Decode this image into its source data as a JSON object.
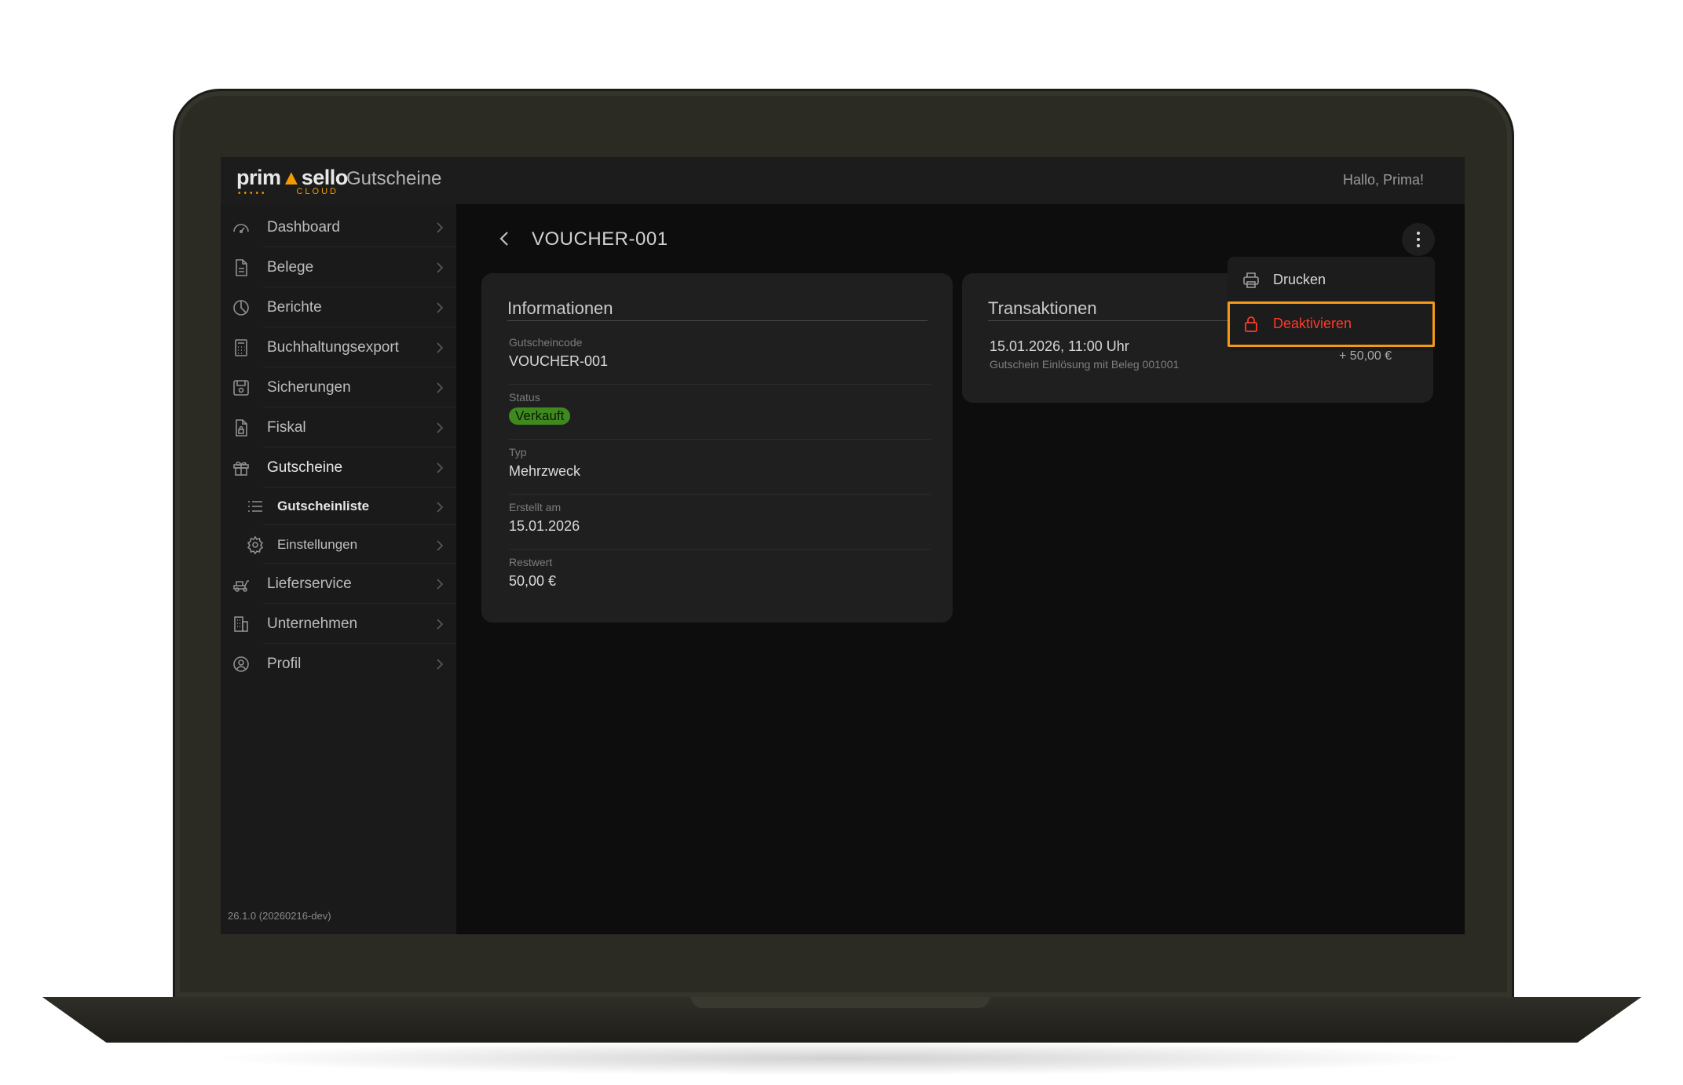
{
  "header": {
    "logo": {
      "word_a": "prim",
      "word_b": "sello",
      "sub": "CLOUD"
    },
    "app_title": "Gutscheine",
    "greeting": "Hallo, Prima!"
  },
  "sidebar": {
    "items": [
      {
        "label": "Dashboard",
        "icon": "gauge-icon"
      },
      {
        "label": "Belege",
        "icon": "document-icon"
      },
      {
        "label": "Berichte",
        "icon": "pie-chart-icon"
      },
      {
        "label": "Buchhaltungsexport",
        "icon": "calculator-icon"
      },
      {
        "label": "Sicherungen",
        "icon": "save-icon"
      },
      {
        "label": "Fiskal",
        "icon": "lock-document-icon"
      },
      {
        "label": "Gutscheine",
        "icon": "gift-icon"
      }
    ],
    "sub_items": [
      {
        "label": "Gutscheinliste",
        "icon": "list-icon"
      },
      {
        "label": "Einstellungen",
        "icon": "gear-icon"
      }
    ],
    "items_after": [
      {
        "label": "Lieferservice",
        "icon": "delivery-icon"
      },
      {
        "label": "Unternehmen",
        "icon": "building-icon"
      },
      {
        "label": "Profil",
        "icon": "user-circle-icon"
      }
    ],
    "version": "26.1.0 (20260216-dev)"
  },
  "main": {
    "title": "VOUCHER-001",
    "info_card": {
      "title": "Informationen",
      "fields": [
        {
          "label": "Gutscheincode",
          "value": "VOUCHER-001"
        },
        {
          "label": "Status",
          "value": "Verkauft"
        },
        {
          "label": "Typ",
          "value": "Mehrzweck"
        },
        {
          "label": "Erstellt am",
          "value": "15.01.2026"
        },
        {
          "label": "Restwert",
          "value": "50,00 €"
        }
      ]
    },
    "transactions_card": {
      "title": "Transaktionen",
      "items": [
        {
          "date": "15.01.2026, 11:00 Uhr",
          "description": "Gutschein Einlösung mit Beleg 001001",
          "amount": "+ 50,00 €"
        }
      ]
    },
    "menu": {
      "items": [
        {
          "label": "Drucken",
          "icon": "printer-icon"
        },
        {
          "label": "Deaktivieren",
          "icon": "lock-icon"
        }
      ]
    }
  },
  "colors": {
    "accent": "#f29a00",
    "status_green": "#3f8a1e",
    "danger": "#ff3b2a",
    "highlight": "#f29a16"
  }
}
